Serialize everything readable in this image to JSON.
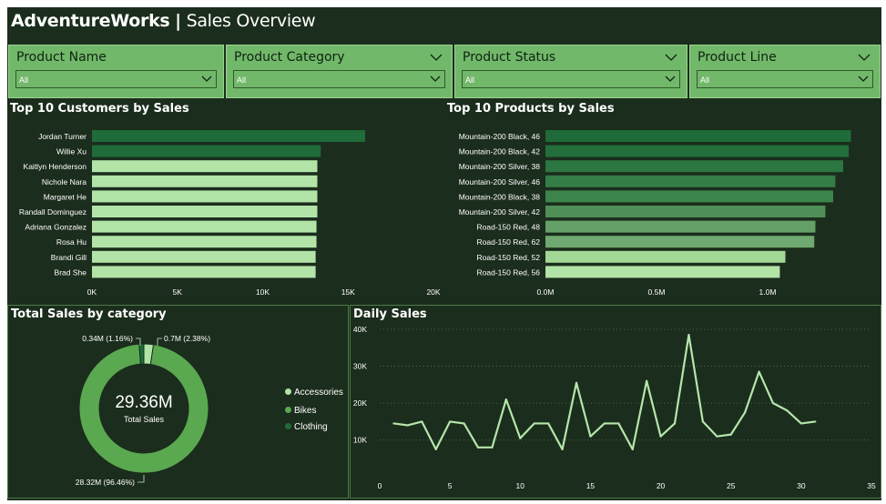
{
  "header": {
    "brand": "AdventureWorks",
    "separator": "|",
    "subtitle": "Sales Overview"
  },
  "slicers": [
    {
      "label": "Product Name",
      "value": "All"
    },
    {
      "label": "Product Category",
      "value": "All"
    },
    {
      "label": "Product Status",
      "value": "All"
    },
    {
      "label": "Product Line",
      "value": "All"
    }
  ],
  "colors": {
    "background": "#1b2d1c",
    "accent": "#72b86a",
    "line": "#b4e6ab"
  },
  "chart_data": [
    {
      "type": "bar",
      "title": "Top 10 Customers by Sales",
      "orientation": "horizontal",
      "categories": [
        "Jordan Turner",
        "Willie Xu",
        "Kaitlyn Henderson",
        "Nichole Nara",
        "Margaret He",
        "Randall Dominguez",
        "Adriana Gonzalez",
        "Rosa Hu",
        "Brandi Gill",
        "Brad She"
      ],
      "values": [
        16000,
        13400,
        13200,
        13200,
        13200,
        13200,
        13150,
        13150,
        13100,
        13100
      ],
      "bar_colors": [
        "#1f6b39",
        "#1f6b39",
        "#b2e3a7",
        "#b2e3a7",
        "#b2e3a7",
        "#b2e3a7",
        "#b2e3a7",
        "#b2e3a7",
        "#b2e3a7",
        "#b2e3a7"
      ],
      "xlim": [
        0,
        20000
      ],
      "xticks": [
        "0K",
        "5K",
        "10K",
        "15K",
        "20K"
      ]
    },
    {
      "type": "bar",
      "title": "Top 10 Products by Sales",
      "orientation": "horizontal",
      "categories": [
        "Mountain-200 Black, 46",
        "Mountain-200 Black, 42",
        "Mountain-200 Silver, 38",
        "Mountain-200 Silver, 46",
        "Mountain-200 Black, 38",
        "Mountain-200 Silver, 42",
        "Road-150 Red, 48",
        "Road-150 Red, 62",
        "Road-150 Red, 52",
        "Road-150 Red, 56"
      ],
      "values": [
        1375000,
        1365000,
        1340000,
        1305000,
        1295000,
        1260000,
        1215000,
        1210000,
        1080000,
        1055000
      ],
      "bar_colors": [
        "#1f6b39",
        "#236f3c",
        "#2b7641",
        "#347d46",
        "#3d844c",
        "#4f8f57",
        "#65a068",
        "#70a871",
        "#a2d796",
        "#b2e3a7"
      ],
      "xlim": [
        0,
        1500000
      ],
      "xticks": [
        "0.0M",
        "0.5M",
        "1.0M"
      ]
    },
    {
      "type": "pie",
      "title": "Total Sales by category",
      "donut": true,
      "center_value": "29.36M",
      "center_label": "Total Sales",
      "slices": [
        {
          "name": "Accessories",
          "value": 0.7,
          "label": "0.7M (2.38%)",
          "color": "#b2e3a7"
        },
        {
          "name": "Bikes",
          "value": 28.32,
          "label": "28.32M (96.46%)",
          "color": "#5aa850"
        },
        {
          "name": "Clothing",
          "value": 0.34,
          "label": "0.34M (1.16%)",
          "color": "#1f6b39"
        }
      ],
      "legend": [
        "Accessories",
        "Bikes",
        "Clothing"
      ]
    },
    {
      "type": "line",
      "title": "Daily Sales",
      "x": [
        1,
        2,
        3,
        4,
        5,
        6,
        7,
        8,
        9,
        10,
        11,
        12,
        13,
        14,
        15,
        16,
        17,
        18,
        19,
        20,
        21,
        22,
        23,
        24,
        25,
        26,
        27,
        28,
        29,
        30,
        31
      ],
      "y": [
        14500,
        14000,
        15000,
        7500,
        15000,
        14500,
        8000,
        8000,
        21000,
        10500,
        14500,
        14500,
        7500,
        25500,
        11000,
        14500,
        14500,
        7500,
        26000,
        11000,
        14500,
        38500,
        15000,
        11000,
        11500,
        17500,
        28500,
        20000,
        18000,
        14500,
        15000
      ],
      "xlim": [
        0,
        35
      ],
      "ylim": [
        5000,
        40000
      ],
      "xticks": [
        "0",
        "5",
        "10",
        "15",
        "20",
        "25",
        "30",
        "35"
      ],
      "yticks": [
        "10K",
        "20K",
        "30K",
        "40K"
      ],
      "grid": true
    }
  ]
}
